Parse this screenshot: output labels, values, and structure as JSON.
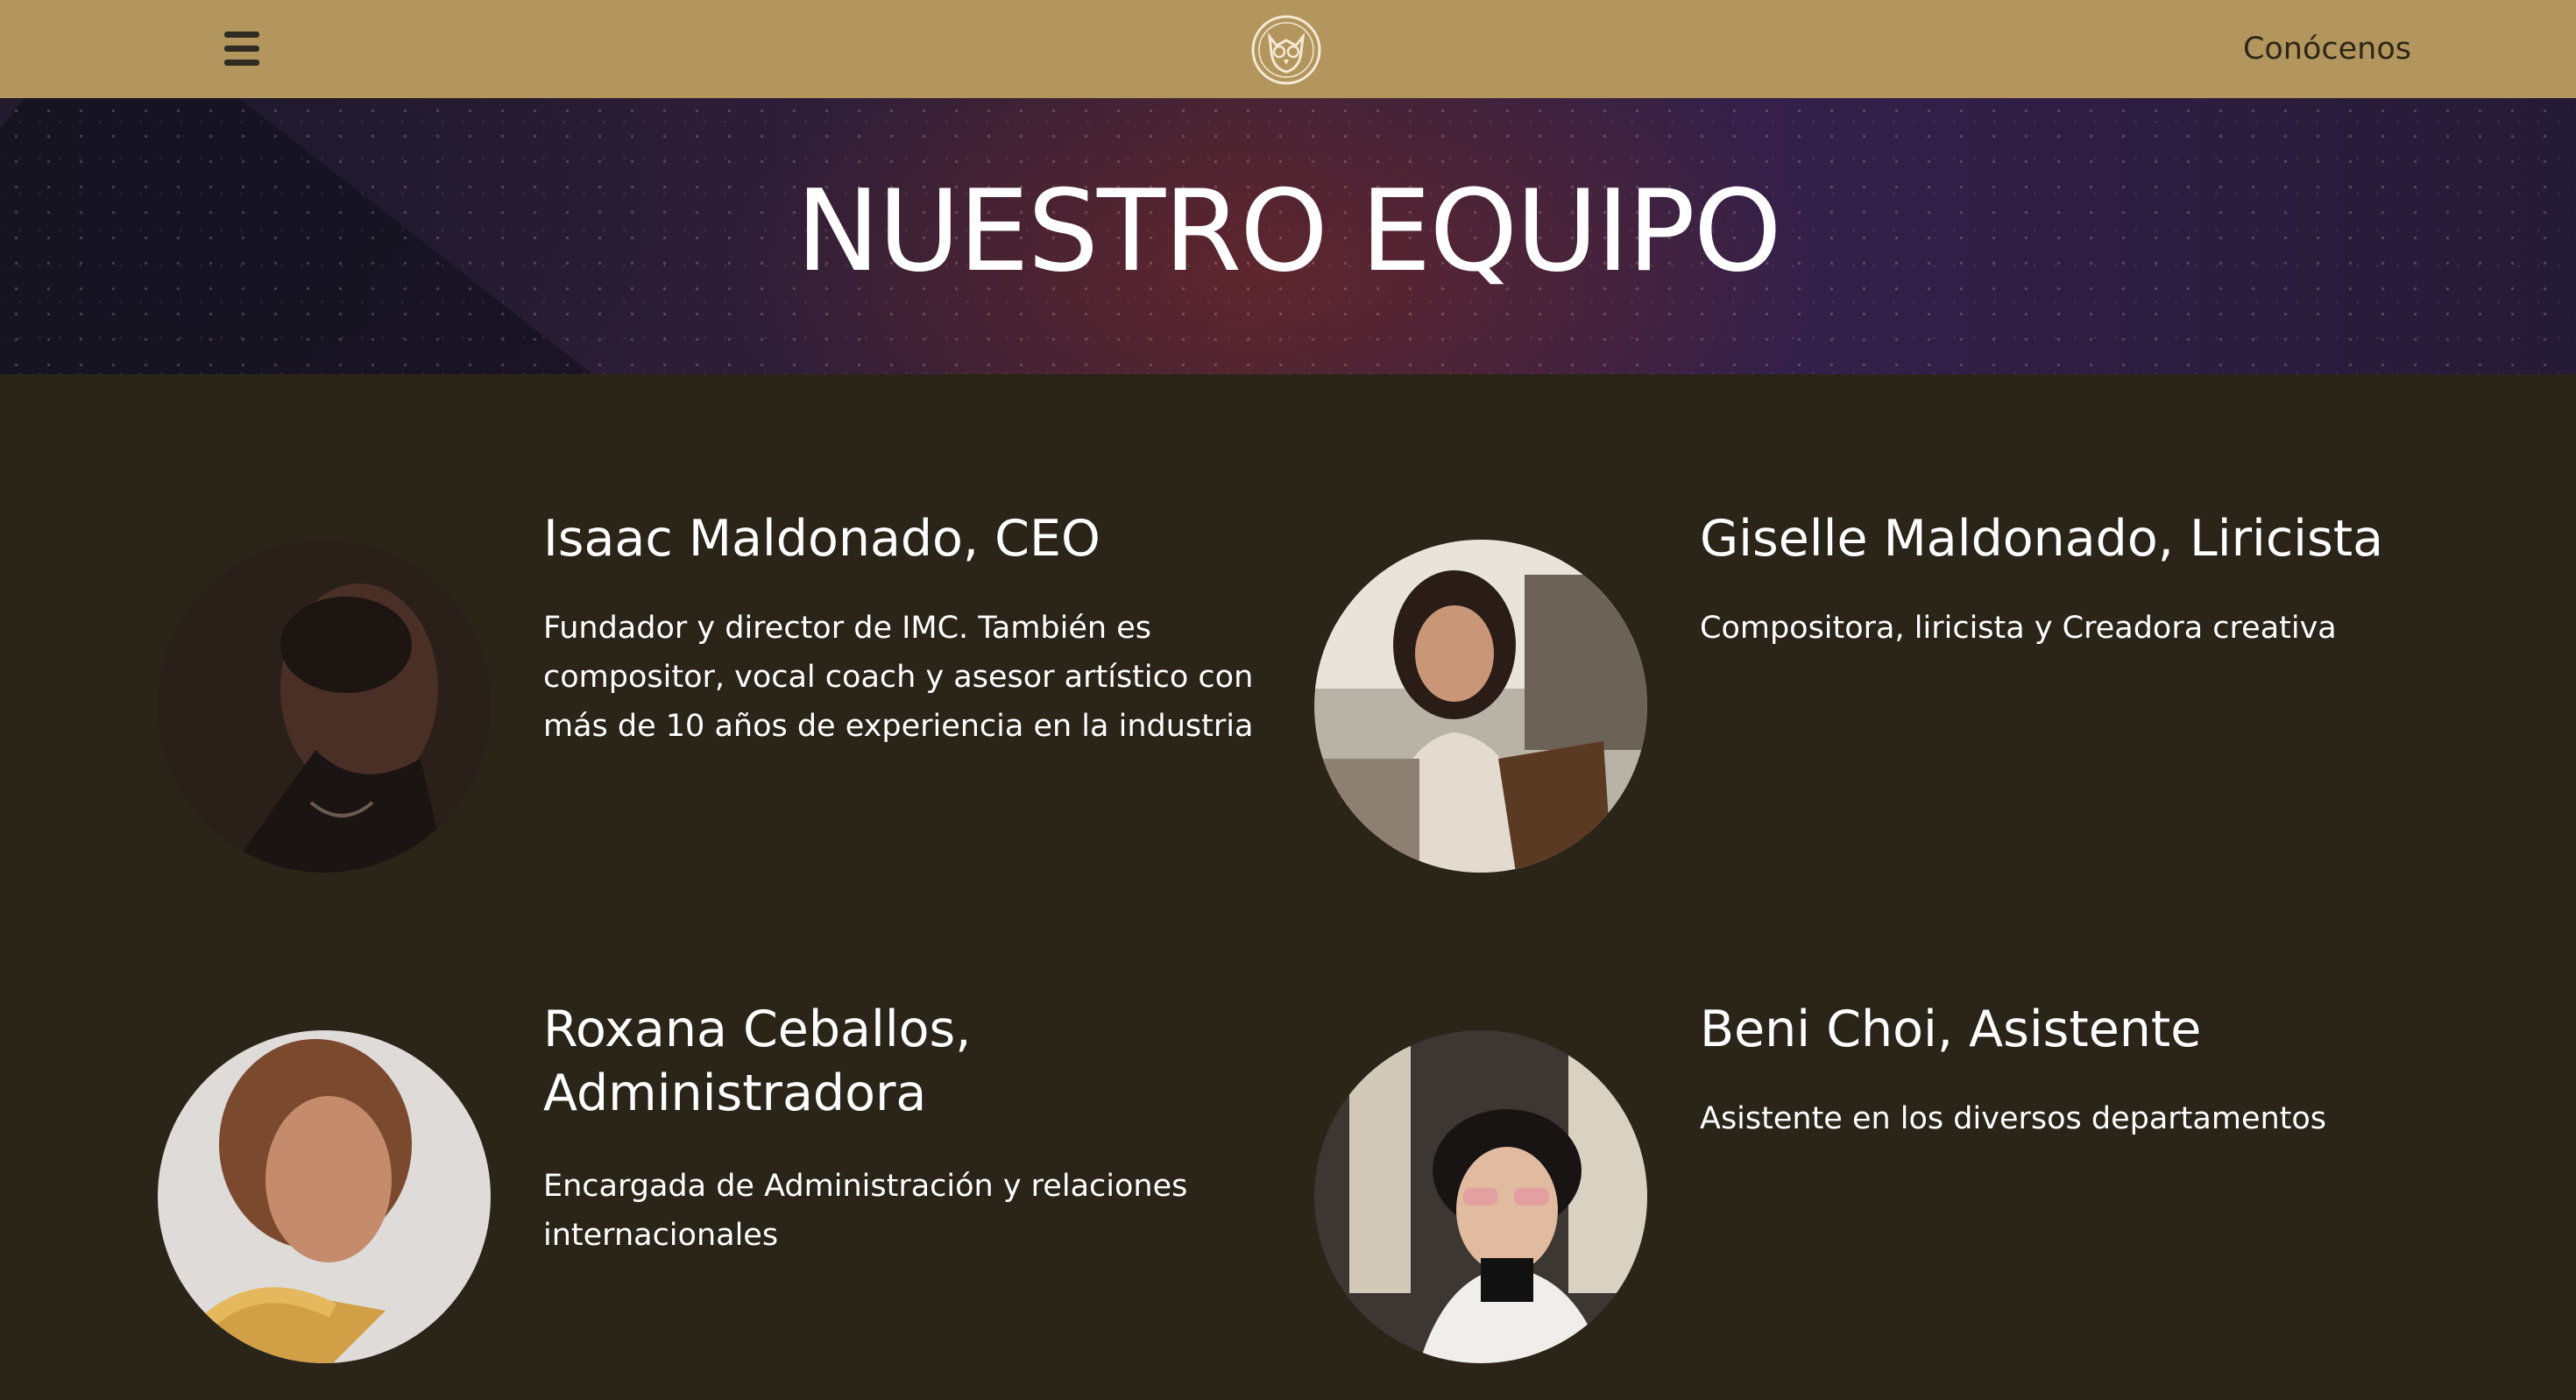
{
  "header": {
    "menu_icon": "hamburger-icon",
    "logo_icon": "owl-crest-icon",
    "nav_link": "Conócenos",
    "background_color": "#b3955e"
  },
  "hero": {
    "title": "NUESTRO EQUIPO"
  },
  "team": [
    {
      "name": "Isaac Maldonado, CEO",
      "description": "Fundador y director de IMC. También es compositor, vocal coach y asesor artístico con más de 10 años de experiencia en la industria"
    },
    {
      "name": "Giselle Maldonado, Liricista",
      "description": "Compositora, liricista y Creadora creativa"
    },
    {
      "name": "Roxana Ceballos, Administradora",
      "description": "Encargada de Administración y relaciones internacionales"
    },
    {
      "name": "Beni Choi, Asistente",
      "description": "Asistente en los diversos departamentos"
    }
  ],
  "colors": {
    "page_background": "#2a2419",
    "text": "#ffffff",
    "header_text": "#2e2718"
  }
}
